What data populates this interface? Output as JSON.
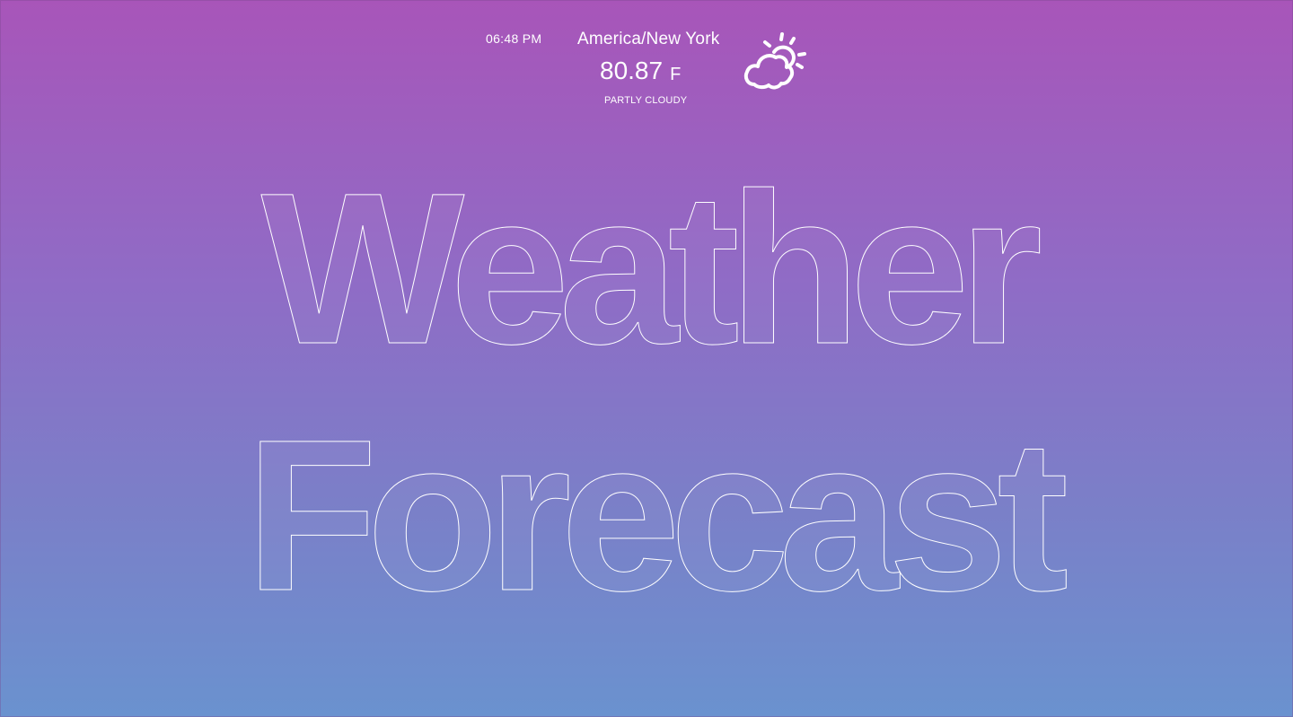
{
  "weather": {
    "time": "06:48 PM",
    "location": "America/New York",
    "temperature": "80.87",
    "unit": "F",
    "condition": "PARTLY CLOUDY",
    "icon": "partly-cloudy-icon"
  },
  "hero": {
    "line1": "Weather",
    "line2": "Forecast"
  },
  "colors": {
    "gradient_top": "#a855b9",
    "gradient_bottom": "#6a92cf",
    "text": "#ffffff"
  }
}
